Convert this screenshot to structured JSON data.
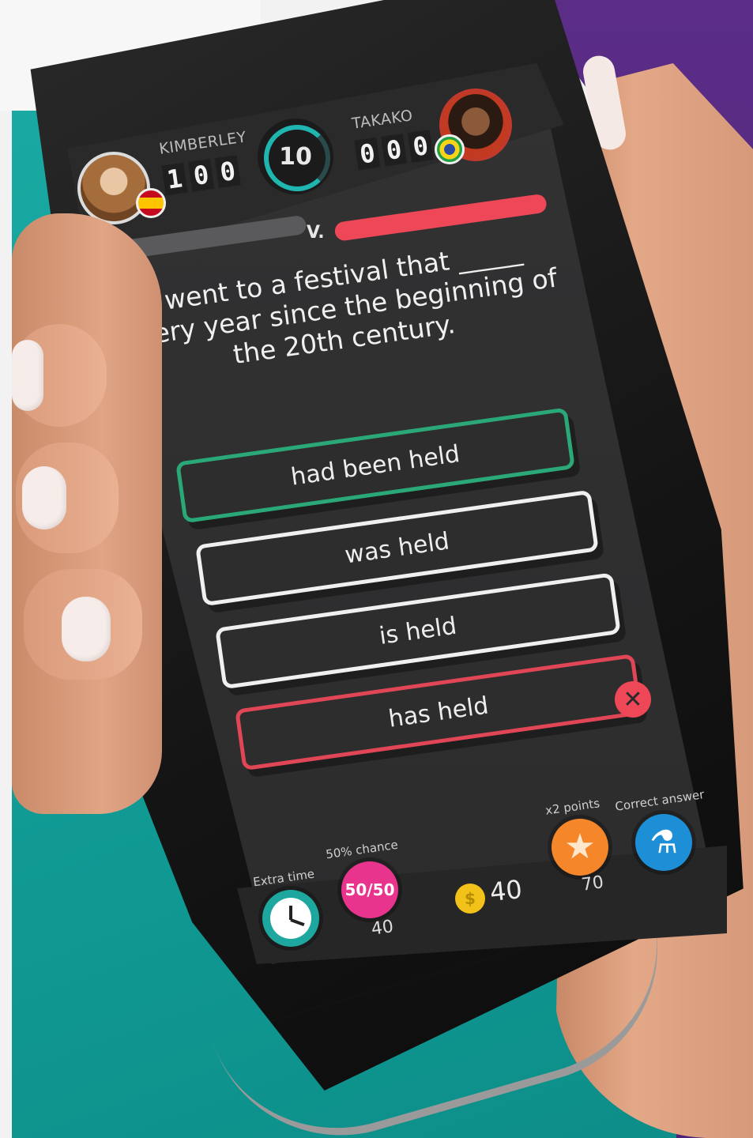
{
  "players": {
    "left": {
      "name": "KIMBERLEY",
      "score_digits": [
        "1",
        "0",
        "0"
      ]
    },
    "right": {
      "name": "TAKAKO",
      "score_digits": [
        "0",
        "0",
        "0"
      ]
    }
  },
  "timer": {
    "value": "10"
  },
  "versus_label": "V.",
  "progress": {
    "left_fraction": 0.12,
    "right_fraction": 1.0
  },
  "question": {
    "text": "I went to a festival that _____ every year since the beginning of the 20th century."
  },
  "answers": [
    {
      "label": "had been held",
      "state": "correct"
    },
    {
      "label": "was held",
      "state": "neutral"
    },
    {
      "label": "is held",
      "state": "neutral"
    },
    {
      "label": "has held",
      "state": "wrong"
    }
  ],
  "wrong_mark": "✕",
  "powerups": {
    "extra_time": {
      "label": "Extra time",
      "icon": "clock-icon"
    },
    "fifty_fifty": {
      "label": "50% chance",
      "icon_text": "50/50",
      "cost": "40"
    },
    "double_points": {
      "label": "x2 points",
      "icon_text": "x2",
      "cost": "70"
    },
    "correct_answer": {
      "label": "Correct answer",
      "icon": "flask-icon"
    }
  },
  "coins": {
    "symbol": "$",
    "amount": "40"
  },
  "colors": {
    "correct": "#2aa877",
    "wrong": "#e04655",
    "accent_teal": "#1fb6b0",
    "progress_green": "#35c47d",
    "progress_red": "#ee4757"
  }
}
